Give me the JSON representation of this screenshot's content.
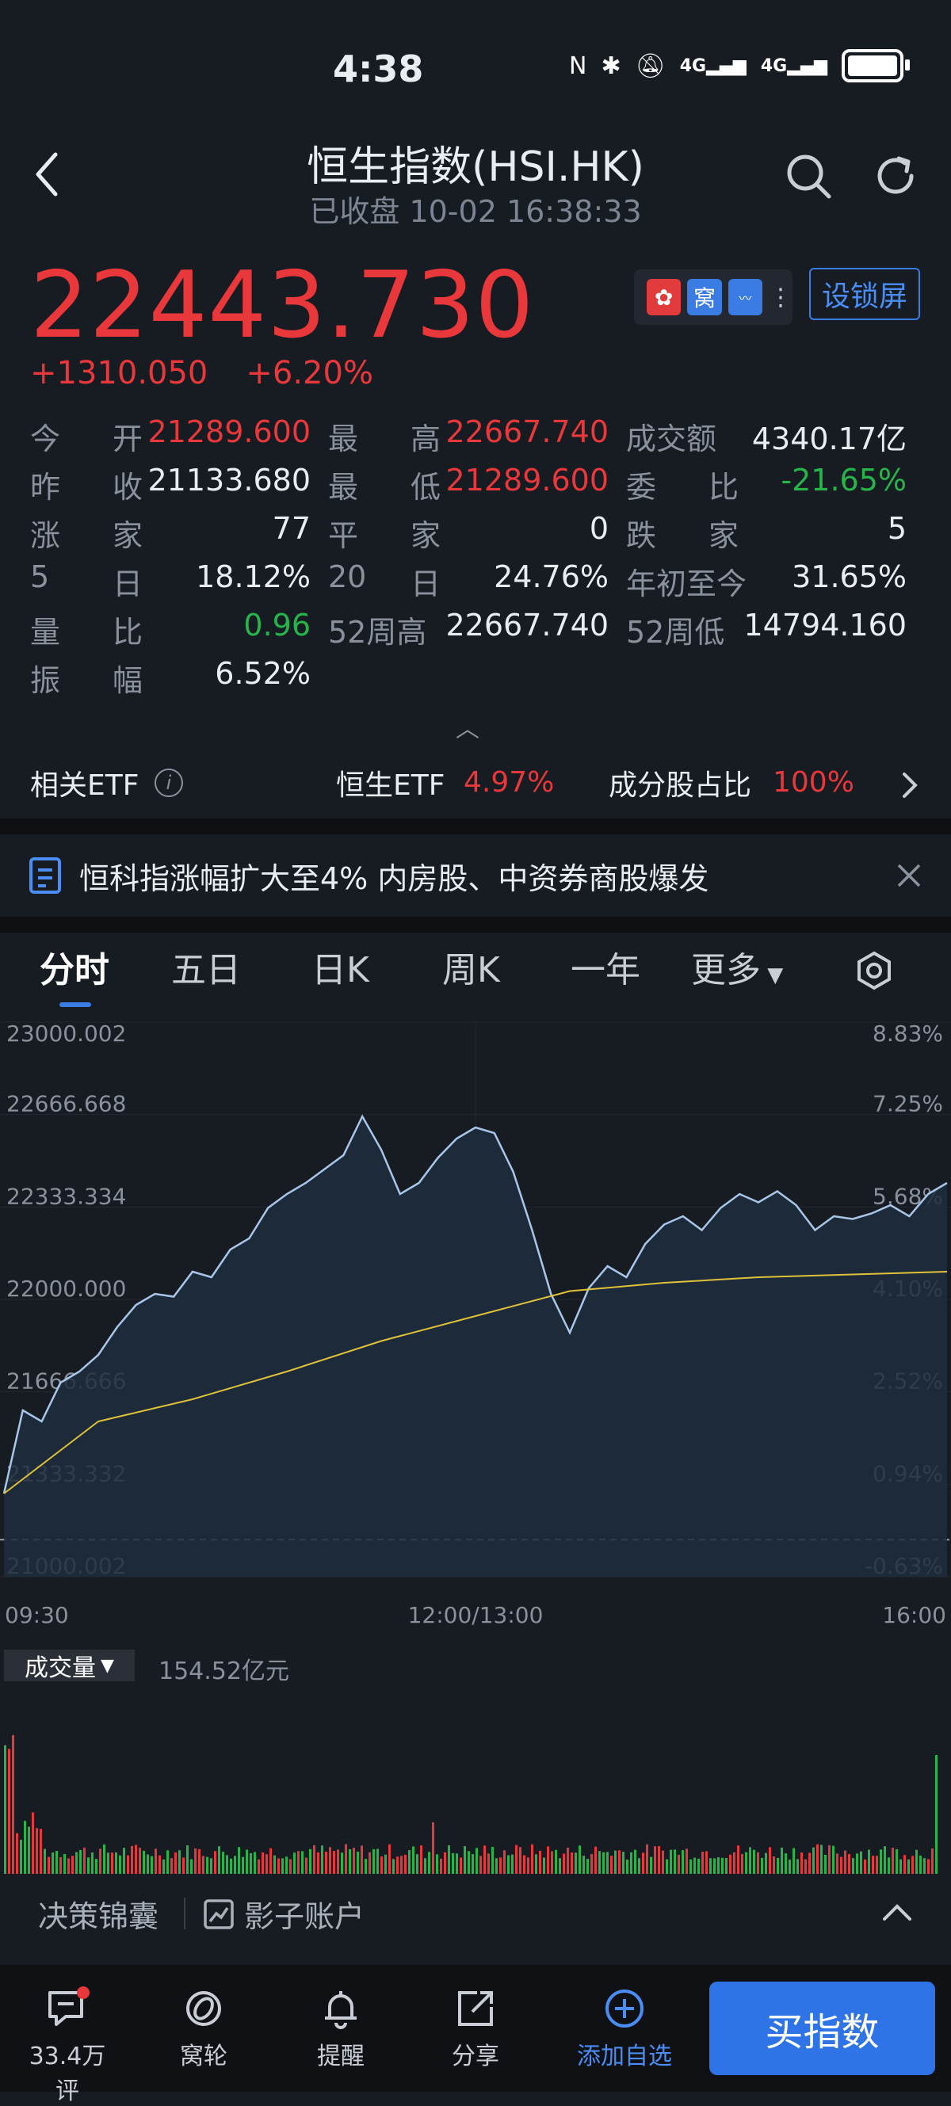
{
  "status": {
    "time": "4:38",
    "net1": "4G",
    "net2": "4G"
  },
  "header": {
    "title": "恒生指数(HSI.HK)",
    "subtitle": "已收盘 10-02 16:38:33"
  },
  "quote": {
    "price": "22443.730",
    "change": "+1310.050",
    "change_pct": "+6.20%",
    "lock_label": "设锁屏",
    "flag_label": "窝"
  },
  "stats": [
    [
      {
        "l1": "今",
        "l2": "开",
        "v": "21289.600",
        "c": "red"
      },
      {
        "l1": "最",
        "l2": "高",
        "v": "22667.740",
        "c": "red"
      },
      {
        "l1": "成交额",
        "l2": "",
        "v": "4340.17亿",
        "c": ""
      }
    ],
    [
      {
        "l1": "昨",
        "l2": "收",
        "v": "21133.680",
        "c": ""
      },
      {
        "l1": "最",
        "l2": "低",
        "v": "21289.600",
        "c": "red"
      },
      {
        "l1": "委",
        "l2": "比",
        "v": "-21.65%",
        "c": "green"
      }
    ],
    [
      {
        "l1": "涨",
        "l2": "家",
        "v": "77",
        "c": ""
      },
      {
        "l1": "平",
        "l2": "家",
        "v": "0",
        "c": ""
      },
      {
        "l1": "跌",
        "l2": "家",
        "v": "5",
        "c": ""
      }
    ],
    [
      {
        "l1": "5",
        "l2": "日",
        "v": "18.12%",
        "c": ""
      },
      {
        "l1": "20",
        "l2": "日",
        "v": "24.76%",
        "c": ""
      },
      {
        "l1": "年初至今",
        "l2": "",
        "v": "31.65%",
        "c": ""
      }
    ],
    [
      {
        "l1": "量",
        "l2": "比",
        "v": "0.96",
        "c": "green"
      },
      {
        "l1": "52周高",
        "l2": "",
        "v": "22667.740",
        "c": ""
      },
      {
        "l1": "52周低",
        "l2": "",
        "v": "14794.160",
        "c": ""
      }
    ],
    [
      {
        "l1": "振",
        "l2": "幅",
        "v": "6.52%",
        "c": ""
      }
    ]
  ],
  "etf": {
    "label": "相关ETF",
    "etf_name": "恒生ETF",
    "etf_pct": "4.97%",
    "ratio_label": "成分股占比",
    "ratio_val": "100%"
  },
  "news": {
    "text": "恒科指涨幅扩大至4% 内房股、中资券商股爆发"
  },
  "tabs": [
    "分时",
    "五日",
    "日K",
    "周K",
    "一年",
    "更多"
  ],
  "chart_data": {
    "type": "line",
    "y_left_ticks": [
      "23000.002",
      "22666.668",
      "22333.334",
      "22000.000",
      "21666.666",
      "21333.332",
      "21000.002"
    ],
    "y_right_ticks": [
      "8.83%",
      "7.25%",
      "5.68%",
      "4.10%",
      "2.52%",
      "0.94%",
      "-0.63%"
    ],
    "x_ticks": [
      "09:30",
      "12:00/13:00",
      "16:00"
    ],
    "ylim": [
      21000.002,
      23000.002
    ],
    "prev_close": 21133.68,
    "series": [
      {
        "x": [
          0,
          2,
          4,
          6,
          8,
          10,
          12,
          14,
          16,
          18,
          20,
          22,
          24,
          26,
          28,
          30,
          32,
          34,
          36,
          38,
          40,
          42,
          44,
          46,
          48,
          50,
          52,
          54,
          56,
          58,
          60,
          62,
          64,
          66,
          68,
          70,
          72,
          74,
          76,
          78,
          80,
          82,
          84,
          86,
          88,
          90,
          92,
          94,
          96,
          98,
          100
        ],
        "values": [
          21300,
          21600,
          21560,
          21700,
          21740,
          21800,
          21900,
          21980,
          22020,
          22010,
          22100,
          22080,
          22180,
          22220,
          22330,
          22380,
          22420,
          22470,
          22520,
          22660,
          22540,
          22380,
          22420,
          22510,
          22580,
          22620,
          22600,
          22460,
          22250,
          22020,
          21880,
          22040,
          22120,
          22080,
          22200,
          22270,
          22300,
          22250,
          22330,
          22380,
          22350,
          22390,
          22340,
          22250,
          22300,
          22290,
          22310,
          22340,
          22300,
          22380,
          22420
        ]
      },
      {
        "x": [
          0,
          10,
          20,
          30,
          40,
          50,
          60,
          70,
          80,
          90,
          100
        ],
        "values": [
          21300,
          21560,
          21640,
          21740,
          21850,
          21940,
          22030,
          22060,
          22080,
          22090,
          22100
        ]
      }
    ]
  },
  "volume": {
    "label": "成交量",
    "value": "154.52亿元"
  },
  "strip": {
    "left": "决策锦囊",
    "right": "影子账户"
  },
  "nav": [
    {
      "label": "33.4万评",
      "icon": "comment-icon"
    },
    {
      "label": "窝轮",
      "icon": "warrant-icon"
    },
    {
      "label": "提醒",
      "icon": "bell-icon"
    },
    {
      "label": "分享",
      "icon": "share-icon"
    },
    {
      "label": "添加自选",
      "icon": "add-watchlist-icon"
    }
  ],
  "buy": {
    "label": "买指数"
  },
  "colors": {
    "up": "#e8383b",
    "down": "#27b54b",
    "accent": "#3a7ce4",
    "line": "#a9c6e8",
    "avg": "#e0c23a"
  }
}
